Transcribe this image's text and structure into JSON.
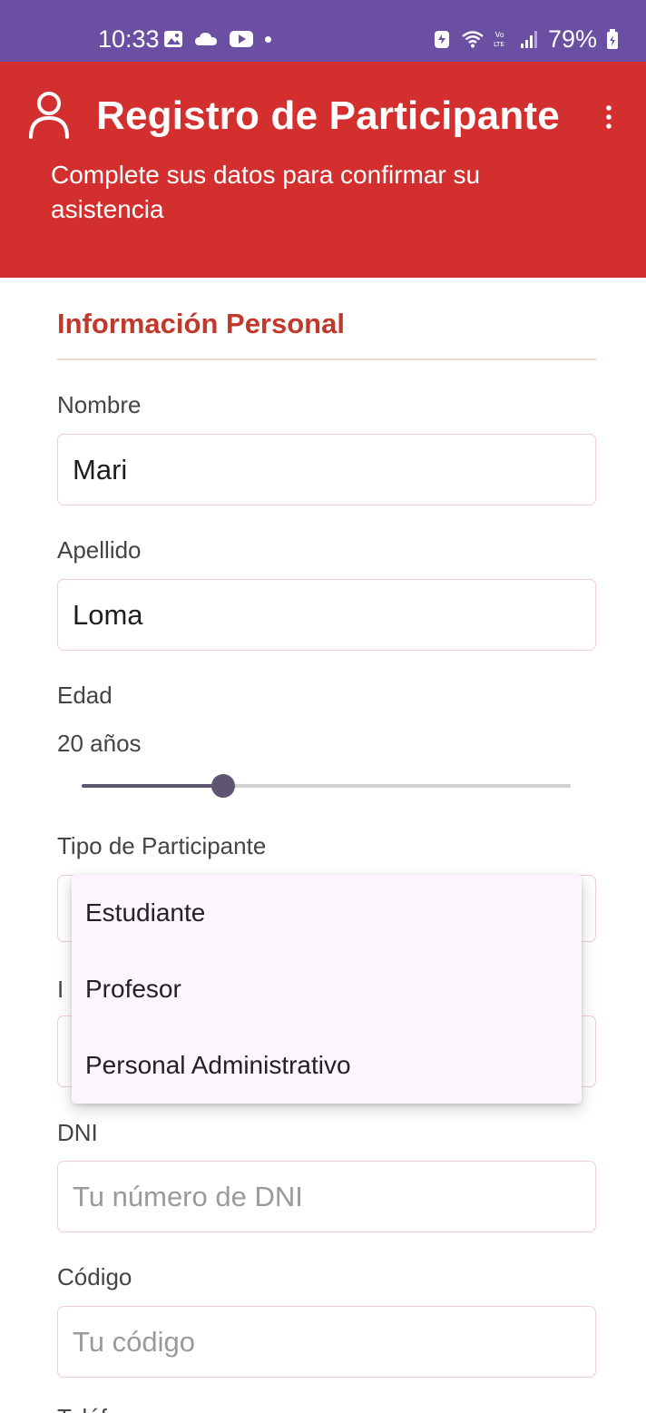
{
  "status_bar": {
    "time": "10:33",
    "battery": "79%",
    "left_icons": [
      "gallery-icon",
      "cloud-icon",
      "youtube-icon",
      "dot-icon"
    ],
    "right_icons": [
      "battery-saver-icon",
      "wifi-icon",
      "volte-icon",
      "signal-icon",
      "battery-icon"
    ]
  },
  "header": {
    "title": "Registro de Participante",
    "subtitle": "Complete sus datos para confirmar su asistencia",
    "color": "#d32f2f"
  },
  "section": {
    "title": "Información Personal"
  },
  "form": {
    "nombre": {
      "label": "Nombre",
      "value": "Mari"
    },
    "apellido": {
      "label": "Apellido",
      "value": "Loma"
    },
    "edad": {
      "label": "Edad",
      "value_text": "20 años",
      "slider_fraction": 0.29
    },
    "tipo": {
      "label": "Tipo de Participante"
    },
    "institucion": {
      "label_partial": "I"
    },
    "dni": {
      "label": "DNI",
      "placeholder": "Tu número de DNI"
    },
    "codigo": {
      "label": "Código",
      "placeholder": "Tu código"
    },
    "telefono": {
      "label_partial": "Teléfono"
    }
  },
  "dropdown": {
    "options": [
      "Estudiante",
      "Profesor",
      "Personal Administrativo"
    ]
  },
  "colors": {
    "status_bar": "#6a4fa3",
    "accent_red": "#c0392b",
    "slider": "#5e5670",
    "menu_bg": "#fcf5fd"
  }
}
